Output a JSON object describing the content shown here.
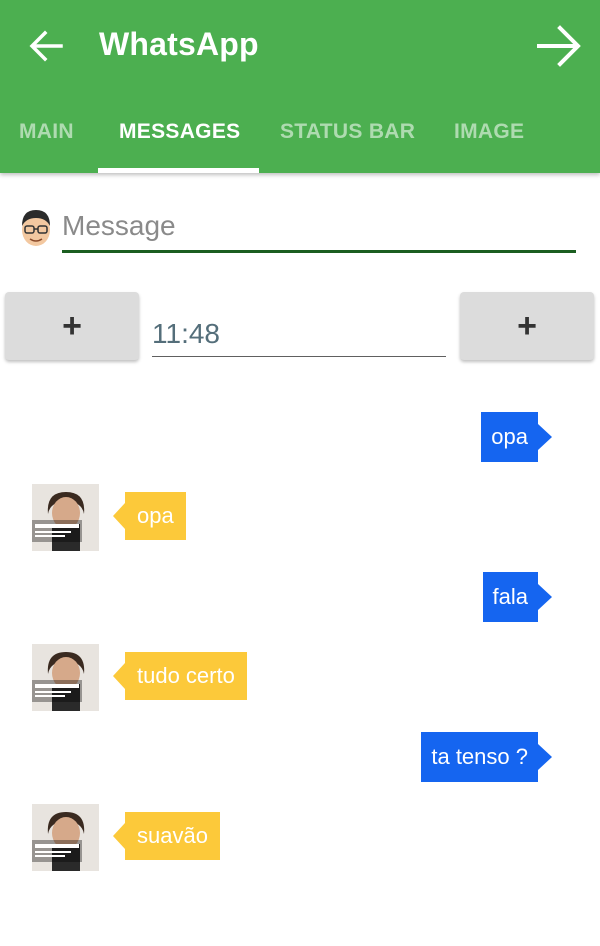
{
  "appbar": {
    "title": "WhatsApp",
    "back_icon": "arrow-left-icon",
    "forward_icon": "arrow-right-icon",
    "color": "#4caf50"
  },
  "tabs": [
    {
      "label": "MAIN",
      "active": false
    },
    {
      "label": "MESSAGES",
      "active": true
    },
    {
      "label": "STATUS BAR",
      "active": false
    },
    {
      "label": "IMAGE",
      "active": false
    }
  ],
  "composer": {
    "placeholder": "Message",
    "value": "",
    "avatar_icon": "user-avatar-icon"
  },
  "time_row": {
    "left_button": "+",
    "right_button": "+",
    "time": "11:48"
  },
  "messages": [
    {
      "side": "out",
      "text": "opa"
    },
    {
      "side": "in",
      "text": "opa"
    },
    {
      "side": "out",
      "text": "fala"
    },
    {
      "side": "in",
      "text": "tudo certo"
    },
    {
      "side": "out",
      "text": "ta tenso ?"
    },
    {
      "side": "in",
      "text": "suavão"
    }
  ],
  "colors": {
    "outgoing_bubble": "#1565f0",
    "incoming_bubble": "#fcc93a"
  }
}
